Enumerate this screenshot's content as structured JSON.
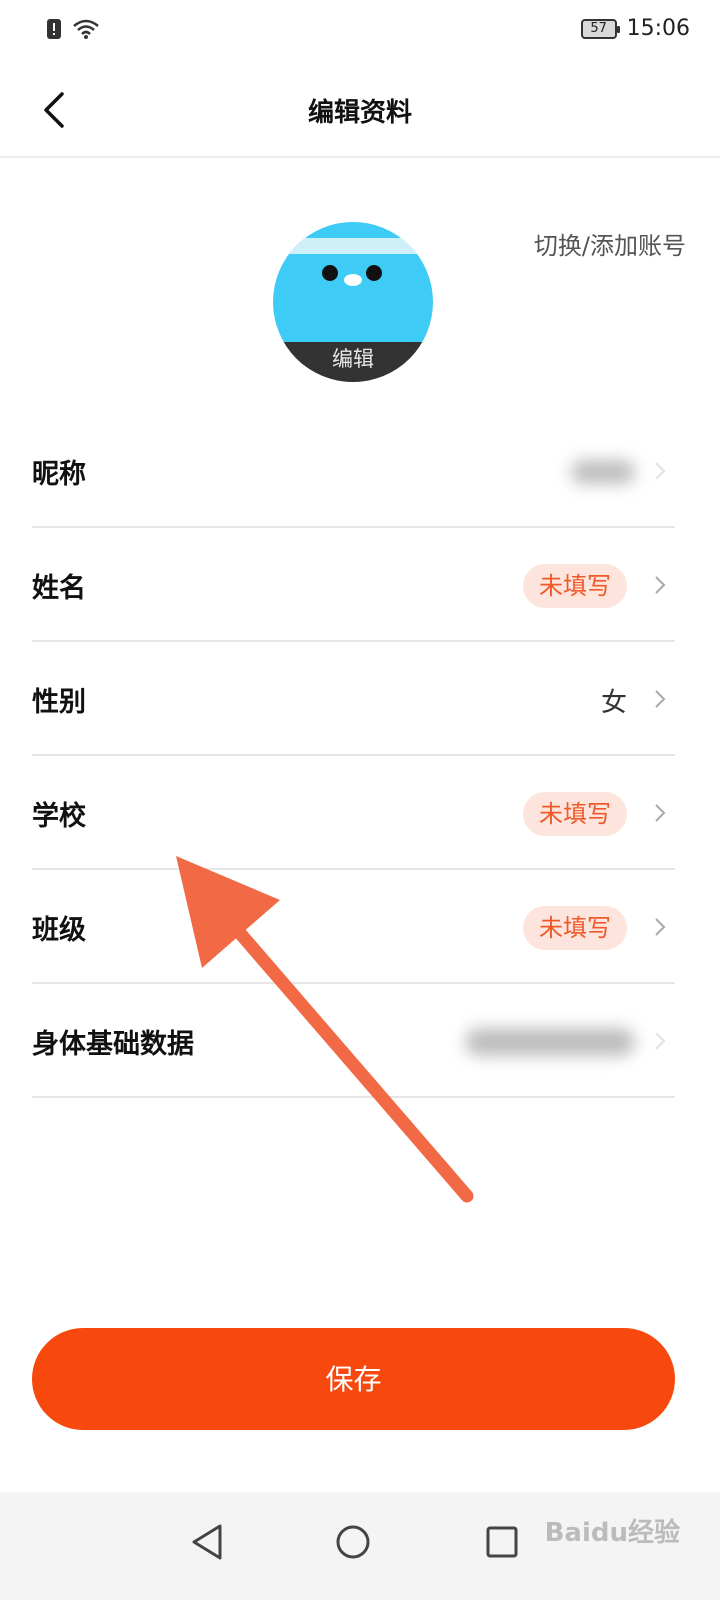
{
  "status_bar": {
    "battery": "57",
    "time": "15:06"
  },
  "header": {
    "title": "编辑资料"
  },
  "profile": {
    "switch_account": "切换/添加账号",
    "avatar_edit": "编辑"
  },
  "fields": [
    {
      "label": "昵称",
      "value": ""
    },
    {
      "label": "姓名",
      "value": "未填写"
    },
    {
      "label": "性别",
      "value": "女"
    },
    {
      "label": "学校",
      "value": "未填写"
    },
    {
      "label": "班级",
      "value": "未填写"
    },
    {
      "label": "身体基础数据",
      "value": ""
    }
  ],
  "save_button": {
    "label": "保存"
  },
  "watermark": {
    "text": "Baidu经验"
  },
  "colors": {
    "accent": "#f7490e",
    "badge_bg": "#fde4dc",
    "badge_text": "#f05a2a",
    "annotation_arrow": "#f26a45"
  }
}
